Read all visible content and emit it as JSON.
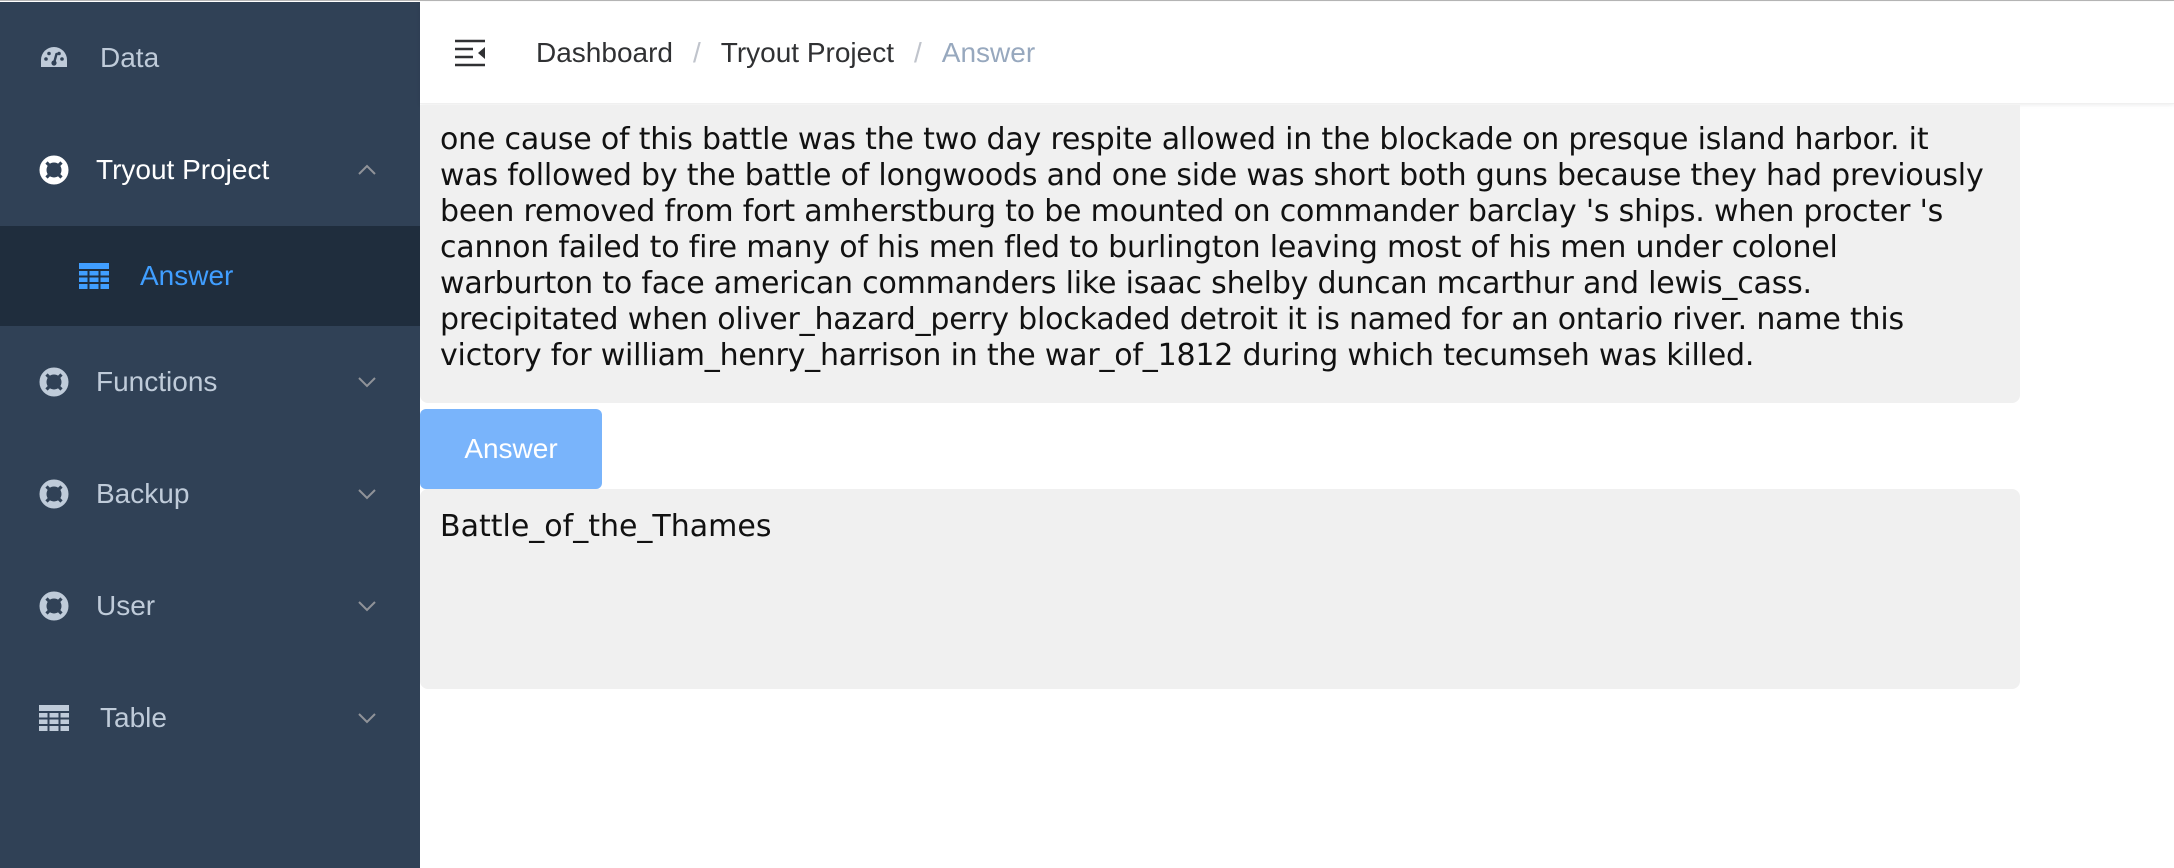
{
  "sidebar": {
    "items": [
      {
        "label": "Data",
        "icon": "dashboard-icon"
      },
      {
        "label": "Tryout Project",
        "icon": "help-circle-icon",
        "expanded": true,
        "children": [
          {
            "label": "Answer",
            "icon": "table-icon",
            "active": true
          }
        ]
      },
      {
        "label": "Functions",
        "icon": "help-circle-icon"
      },
      {
        "label": "Backup",
        "icon": "help-circle-icon"
      },
      {
        "label": "User",
        "icon": "help-circle-icon"
      },
      {
        "label": "Table",
        "icon": "table-icon"
      }
    ]
  },
  "header": {
    "breadcrumb": [
      "Dashboard",
      "Tryout Project",
      "Answer"
    ],
    "separator": "/"
  },
  "main": {
    "question_lines": [
      "one cause of this battle was the two day respite allowed in the blockade on presque island harbor. it",
      "was followed by the battle of longwoods and one side was short both guns because they had previously",
      "been removed from fort amherstburg to be mounted on commander barclay 's ships. when procter 's",
      "cannon failed to fire many of his men fled to burlington leaving most of his men under colonel",
      "warburton to face american commanders like isaac shelby duncan mcarthur and lewis_cass.",
      "precipitated when oliver_hazard_perry blockaded detroit it is named for an ontario river. name this",
      "victory for william_henry_harrison in the war_of_1812 during which tecumseh was killed."
    ],
    "answer_button_label": "Answer",
    "answer_text": "Battle_of_the_Thames"
  },
  "colors": {
    "sidebar_bg": "#304156",
    "submenu_bg": "#1f2d3d",
    "sidebar_text": "#bfcbd9",
    "active_text": "#409eff",
    "button_bg": "#79b4fb",
    "box_bg": "#f0f0f0",
    "breadcrumb_current": "#97a8be"
  }
}
